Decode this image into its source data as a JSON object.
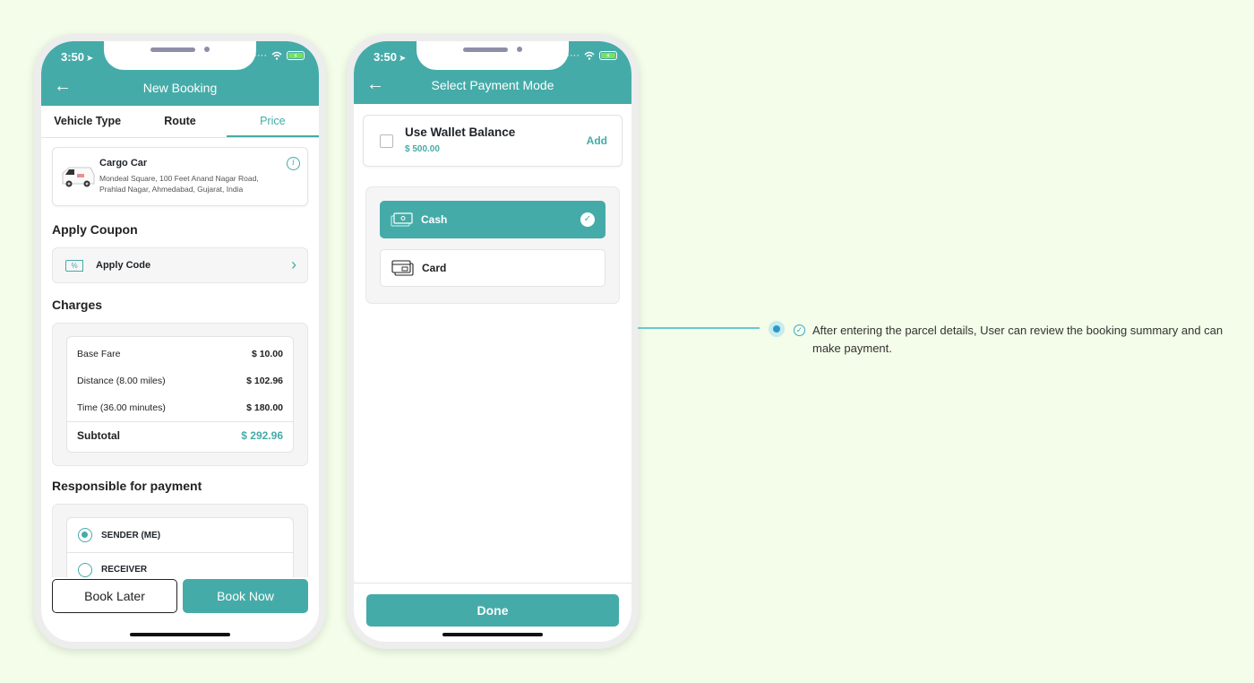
{
  "colors": {
    "accent": "#45aba8",
    "background": "#f3fde9",
    "connector": "#6cc7cf"
  },
  "status_bar": {
    "time": "3:50"
  },
  "booking_screen": {
    "title": "New Booking",
    "tabs": [
      {
        "label": "Vehicle Type",
        "active": false
      },
      {
        "label": "Route",
        "active": false
      },
      {
        "label": "Price",
        "active": true
      }
    ],
    "vehicle": {
      "name": "Cargo Car",
      "address": "Mondeal Square, 100 Feet Anand Nagar Road, Prahlad Nagar, Ahmedabad, Gujarat, India"
    },
    "coupon": {
      "section_title": "Apply Coupon",
      "label": "Apply Code",
      "tag_glyph": "%"
    },
    "charges": {
      "section_title": "Charges",
      "rows": [
        {
          "label": "Base Fare",
          "amount": "$ 10.00"
        },
        {
          "label": "Distance (8.00 miles)",
          "amount": "$ 102.96"
        },
        {
          "label": "Time (36.00 minutes)",
          "amount": "$ 180.00"
        }
      ],
      "subtotal_label": "Subtotal",
      "subtotal_amount": "$ 292.96"
    },
    "payer": {
      "section_title": "Responsible for payment",
      "options": [
        {
          "label": "SENDER (ME)",
          "selected": true
        },
        {
          "label": "RECEIVER",
          "selected": false
        }
      ]
    },
    "buttons": {
      "book_later": "Book Later",
      "book_now": "Book Now"
    }
  },
  "payment_screen": {
    "title": "Select Payment Mode",
    "wallet": {
      "label": "Use Wallet Balance",
      "balance": "$ 500.00",
      "add_label": "Add",
      "checked": false
    },
    "methods": [
      {
        "label": "Cash",
        "selected": true
      },
      {
        "label": "Card",
        "selected": false
      }
    ],
    "done_label": "Done"
  },
  "annotation": {
    "text": "After entering the parcel details, User can review the booking summary and can make payment."
  }
}
